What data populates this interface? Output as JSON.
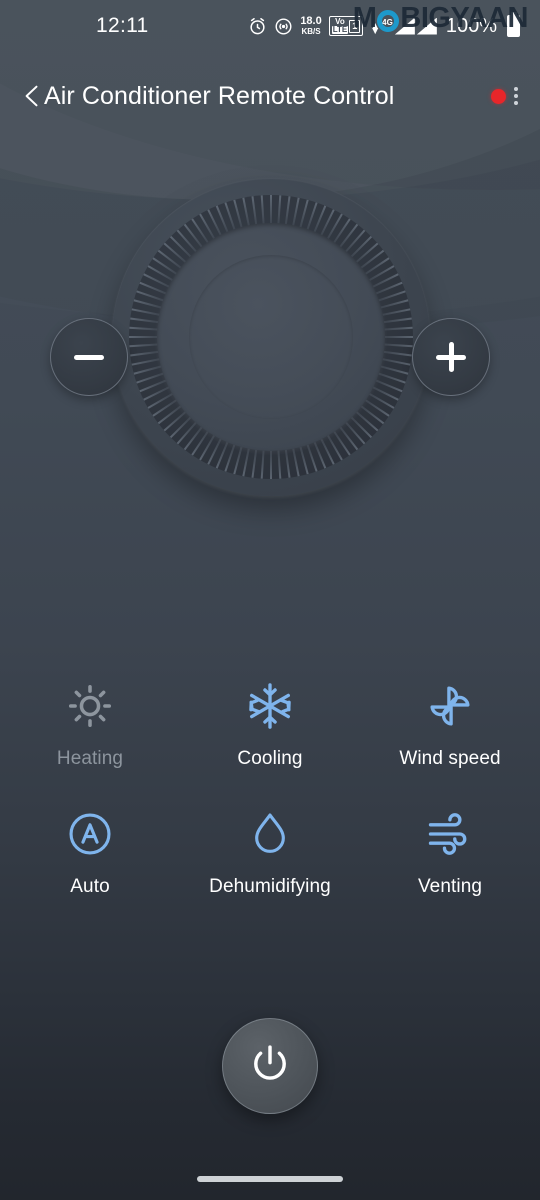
{
  "status_bar": {
    "time": "12:11",
    "alarm_icon": "alarm-clock-icon",
    "hotspot_icon": "wifi-hotspot-icon",
    "net_speed_value": "18.0",
    "net_speed_unit": "KB/S",
    "volte_top": "Vo",
    "volte_bottom": "LTE",
    "sim_number": "1",
    "network_type": "4G",
    "battery_percent": "100%",
    "battery_icon": "battery-full-icon"
  },
  "watermark": {
    "part1": "M",
    "part2": "BIGYAAN",
    "ring_color": "#1a9fd4",
    "text_color": "#1d2a37"
  },
  "title_bar": {
    "back_icon": "back-arrow-icon",
    "title": "Air Conditioner Remote Control",
    "record_indicator": "recording-dot-icon",
    "record_color": "#e8262a",
    "overflow_icon": "kebab-menu-icon"
  },
  "dial": {
    "decrease_label": "−",
    "increase_label": "+",
    "decrease_icon": "minus-icon",
    "increase_icon": "plus-icon",
    "tick_count": 96,
    "temperature_display": ""
  },
  "modes": [
    {
      "id": "heating",
      "label": "Heating",
      "icon": "sun-icon",
      "active": false,
      "color": "#8d959e"
    },
    {
      "id": "cooling",
      "label": "Cooling",
      "icon": "snowflake-icon",
      "active": true,
      "color": "#7fb4ec"
    },
    {
      "id": "wind-speed",
      "label": "Wind speed",
      "icon": "fan-icon",
      "active": true,
      "color": "#7fb4ec"
    },
    {
      "id": "auto",
      "label": "Auto",
      "icon": "auto-a-icon",
      "active": true,
      "color": "#7fb4ec"
    },
    {
      "id": "dehumidifying",
      "label": "Dehumidifying",
      "icon": "water-drop-icon",
      "active": true,
      "color": "#7fb4ec"
    },
    {
      "id": "venting",
      "label": "Venting",
      "icon": "wind-icon",
      "active": true,
      "color": "#7fb4ec"
    }
  ],
  "power": {
    "icon": "power-icon",
    "label": "Power"
  },
  "navigation": {
    "gesture_handle": "gesture-home-bar"
  },
  "theme": {
    "background_top": "#444d58",
    "background_bottom": "#22262d",
    "accent_blue": "#7fb4ec",
    "text_primary": "#ffffff",
    "text_muted": "#8d959e"
  }
}
